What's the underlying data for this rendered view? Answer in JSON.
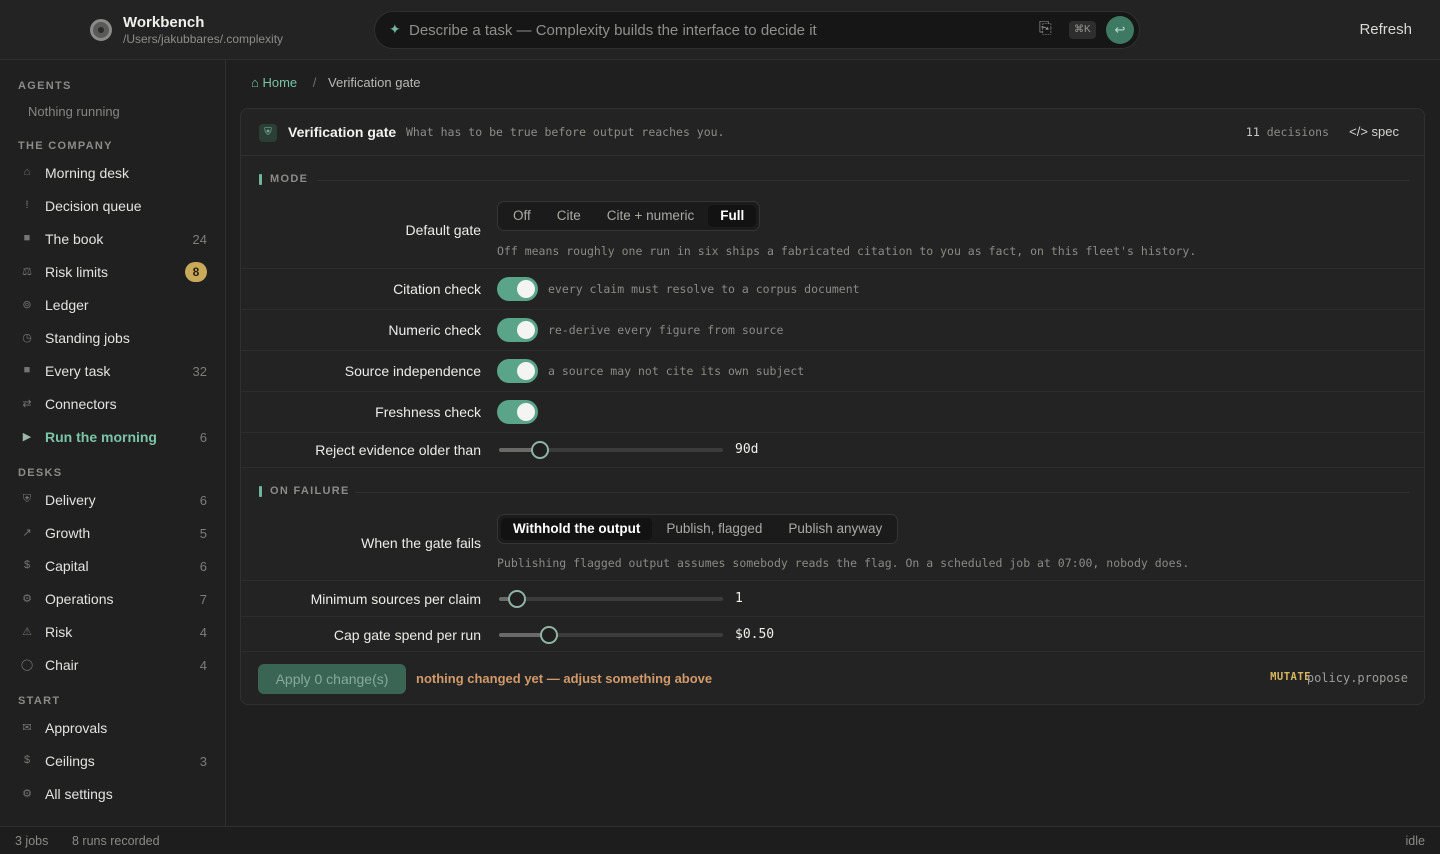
{
  "app": {
    "title": "Workbench",
    "path": "/Users/jakubbares/.complexity",
    "search_placeholder": "Describe a task — Complexity builds the interface to decide it",
    "shortcut": "⌘K",
    "refresh_label": "Refresh"
  },
  "sidebar": {
    "agents_heading": "AGENTS",
    "nothing_running": "Nothing running",
    "company_heading": "THE COMPANY",
    "company": [
      {
        "label": "Morning desk",
        "icon": "home-icon",
        "count": ""
      },
      {
        "label": "Decision queue",
        "icon": "exclamation-icon",
        "count": ""
      },
      {
        "label": "The book",
        "icon": "square-icon",
        "count": "24"
      },
      {
        "label": "Risk limits",
        "icon": "scale-icon",
        "badge": "8"
      },
      {
        "label": "Ledger",
        "icon": "ledger-icon",
        "count": ""
      },
      {
        "label": "Standing jobs",
        "icon": "clock-icon",
        "count": ""
      },
      {
        "label": "Every task",
        "icon": "square-icon",
        "count": "32"
      },
      {
        "label": "Connectors",
        "icon": "arrows-icon",
        "count": ""
      },
      {
        "label": "Run the morning",
        "icon": "play-icon",
        "count": "6",
        "active": true
      }
    ],
    "desks_heading": "DESKS",
    "desks": [
      {
        "label": "Delivery",
        "icon": "shield-icon",
        "count": "6"
      },
      {
        "label": "Growth",
        "icon": "trend-arrow-icon",
        "count": "5"
      },
      {
        "label": "Capital",
        "icon": "dollar-icon",
        "count": "6"
      },
      {
        "label": "Operations",
        "icon": "gear-icon",
        "count": "7"
      },
      {
        "label": "Risk",
        "icon": "warning-icon",
        "count": "4"
      },
      {
        "label": "Chair",
        "icon": "circle-icon",
        "count": "4"
      }
    ],
    "start_heading": "START",
    "start": [
      {
        "label": "Approvals",
        "icon": "mail-icon",
        "count": ""
      },
      {
        "label": "Ceilings",
        "icon": "dollar-icon",
        "count": "3"
      },
      {
        "label": "All settings",
        "icon": "gear-icon",
        "count": ""
      }
    ]
  },
  "breadcrumb": {
    "home": "⌂ Home",
    "separator": "/",
    "current": "Verification gate"
  },
  "panel": {
    "title": "Verification gate",
    "subtitle": "What has to be true before output reaches you.",
    "decisions_count": "11",
    "decisions_label": "decisions",
    "spec_label": "</> spec",
    "mode_heading": "MODE",
    "default_gate": {
      "label": "Default gate",
      "options": [
        "Off",
        "Cite",
        "Cite + numeric",
        "Full"
      ],
      "selected": "Full",
      "help": "Off means roughly one run in six ships a fabricated citation to you as fact, on this fleet's history."
    },
    "toggles": [
      {
        "label": "Citation check",
        "on": true,
        "note": "every claim must resolve to a corpus document"
      },
      {
        "label": "Numeric check",
        "on": true,
        "note": "re-derive every figure from source"
      },
      {
        "label": "Source independence",
        "on": true,
        "note": "a source may not cite its own subject"
      },
      {
        "label": "Freshness check",
        "on": true,
        "note": ""
      }
    ],
    "reject_older": {
      "label": "Reject evidence older than",
      "value": "90d",
      "fraction": 0.12
    },
    "failure_heading": "ON FAILURE",
    "when_fails": {
      "label": "When the gate fails",
      "options": [
        "Withhold the output",
        "Publish, flagged",
        "Publish anyway"
      ],
      "selected": "Withhold the output",
      "help": "Publishing flagged output assumes somebody reads the flag. On a scheduled job at 07:00, nobody does."
    },
    "min_sources": {
      "label": "Minimum sources per claim",
      "value": "1",
      "fraction": 0.0
    },
    "cap_spend": {
      "label": "Cap gate spend per run",
      "value": "$0.50",
      "fraction": 0.17
    },
    "apply_label": "Apply 0 change(s)",
    "apply_note": "nothing changed yet — adjust something above",
    "mutate_tag": "MUTATE",
    "policy_name": "policy.propose"
  },
  "status": {
    "jobs": "3 jobs",
    "runs": "8 runs recorded",
    "state": "idle"
  },
  "colors": {
    "accent": "#6fb59b",
    "toggle_on": "#5aa48a",
    "badge": "#c9a95a",
    "warning_text": "#d29a6a"
  }
}
